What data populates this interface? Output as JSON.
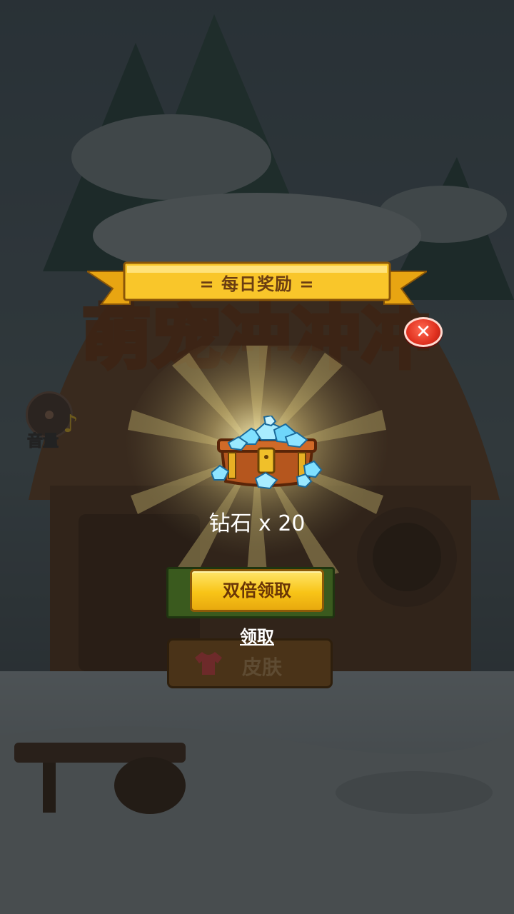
{
  "game": {
    "title": "萌宠冲冲冲"
  },
  "sidebar": {
    "volume_label": "音量"
  },
  "menu": {
    "skin_label": "皮肤"
  },
  "dialog": {
    "title": "=  每日奖励  =",
    "reward_text": "钻石 x 20",
    "double_claim_label": "双倍领取",
    "claim_label": "领取",
    "close_icon": "close-icon"
  },
  "colors": {
    "ribbon": "#f9c62a",
    "double_button": "#f8c417",
    "close_button": "#e0311f"
  }
}
